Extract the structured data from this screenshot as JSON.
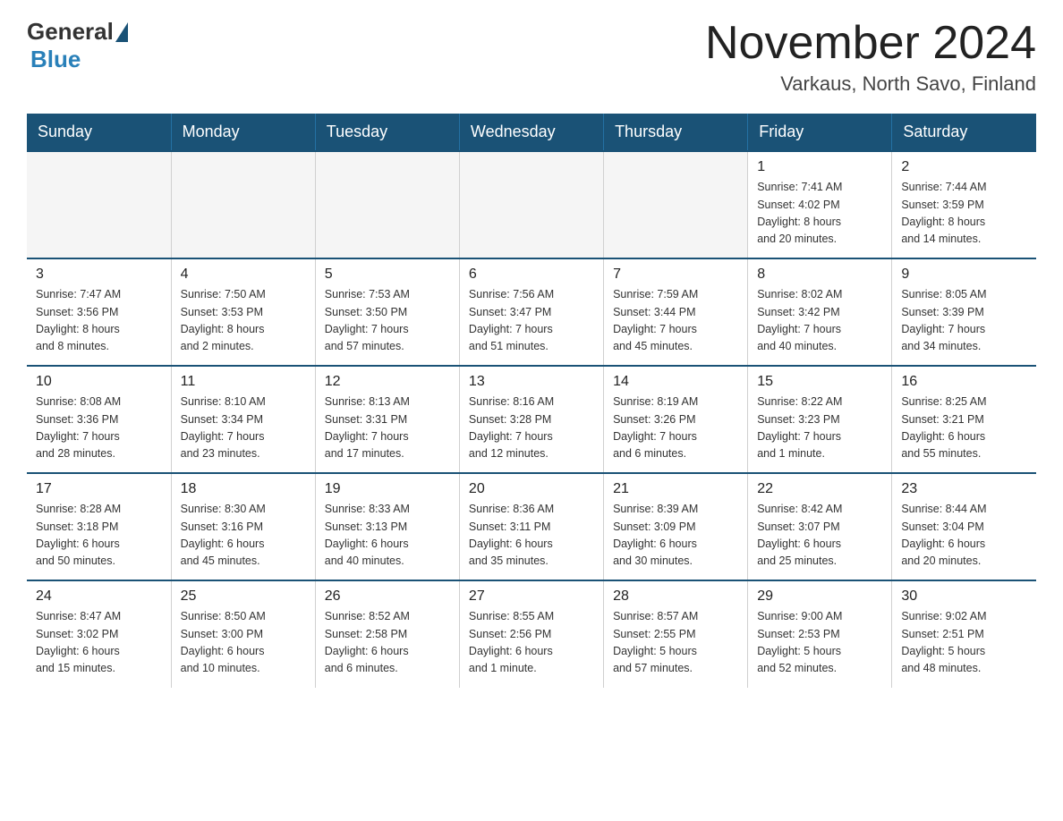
{
  "logo": {
    "general": "General",
    "blue": "Blue"
  },
  "header": {
    "month_title": "November 2024",
    "location": "Varkaus, North Savo, Finland"
  },
  "days_of_week": [
    "Sunday",
    "Monday",
    "Tuesday",
    "Wednesday",
    "Thursday",
    "Friday",
    "Saturday"
  ],
  "weeks": [
    {
      "cells": [
        {
          "day": "",
          "info": "",
          "empty": true
        },
        {
          "day": "",
          "info": "",
          "empty": true
        },
        {
          "day": "",
          "info": "",
          "empty": true
        },
        {
          "day": "",
          "info": "",
          "empty": true
        },
        {
          "day": "",
          "info": "",
          "empty": true
        },
        {
          "day": "1",
          "info": "Sunrise: 7:41 AM\nSunset: 4:02 PM\nDaylight: 8 hours\nand 20 minutes.",
          "empty": false
        },
        {
          "day": "2",
          "info": "Sunrise: 7:44 AM\nSunset: 3:59 PM\nDaylight: 8 hours\nand 14 minutes.",
          "empty": false
        }
      ]
    },
    {
      "cells": [
        {
          "day": "3",
          "info": "Sunrise: 7:47 AM\nSunset: 3:56 PM\nDaylight: 8 hours\nand 8 minutes.",
          "empty": false
        },
        {
          "day": "4",
          "info": "Sunrise: 7:50 AM\nSunset: 3:53 PM\nDaylight: 8 hours\nand 2 minutes.",
          "empty": false
        },
        {
          "day": "5",
          "info": "Sunrise: 7:53 AM\nSunset: 3:50 PM\nDaylight: 7 hours\nand 57 minutes.",
          "empty": false
        },
        {
          "day": "6",
          "info": "Sunrise: 7:56 AM\nSunset: 3:47 PM\nDaylight: 7 hours\nand 51 minutes.",
          "empty": false
        },
        {
          "day": "7",
          "info": "Sunrise: 7:59 AM\nSunset: 3:44 PM\nDaylight: 7 hours\nand 45 minutes.",
          "empty": false
        },
        {
          "day": "8",
          "info": "Sunrise: 8:02 AM\nSunset: 3:42 PM\nDaylight: 7 hours\nand 40 minutes.",
          "empty": false
        },
        {
          "day": "9",
          "info": "Sunrise: 8:05 AM\nSunset: 3:39 PM\nDaylight: 7 hours\nand 34 minutes.",
          "empty": false
        }
      ]
    },
    {
      "cells": [
        {
          "day": "10",
          "info": "Sunrise: 8:08 AM\nSunset: 3:36 PM\nDaylight: 7 hours\nand 28 minutes.",
          "empty": false
        },
        {
          "day": "11",
          "info": "Sunrise: 8:10 AM\nSunset: 3:34 PM\nDaylight: 7 hours\nand 23 minutes.",
          "empty": false
        },
        {
          "day": "12",
          "info": "Sunrise: 8:13 AM\nSunset: 3:31 PM\nDaylight: 7 hours\nand 17 minutes.",
          "empty": false
        },
        {
          "day": "13",
          "info": "Sunrise: 8:16 AM\nSunset: 3:28 PM\nDaylight: 7 hours\nand 12 minutes.",
          "empty": false
        },
        {
          "day": "14",
          "info": "Sunrise: 8:19 AM\nSunset: 3:26 PM\nDaylight: 7 hours\nand 6 minutes.",
          "empty": false
        },
        {
          "day": "15",
          "info": "Sunrise: 8:22 AM\nSunset: 3:23 PM\nDaylight: 7 hours\nand 1 minute.",
          "empty": false
        },
        {
          "day": "16",
          "info": "Sunrise: 8:25 AM\nSunset: 3:21 PM\nDaylight: 6 hours\nand 55 minutes.",
          "empty": false
        }
      ]
    },
    {
      "cells": [
        {
          "day": "17",
          "info": "Sunrise: 8:28 AM\nSunset: 3:18 PM\nDaylight: 6 hours\nand 50 minutes.",
          "empty": false
        },
        {
          "day": "18",
          "info": "Sunrise: 8:30 AM\nSunset: 3:16 PM\nDaylight: 6 hours\nand 45 minutes.",
          "empty": false
        },
        {
          "day": "19",
          "info": "Sunrise: 8:33 AM\nSunset: 3:13 PM\nDaylight: 6 hours\nand 40 minutes.",
          "empty": false
        },
        {
          "day": "20",
          "info": "Sunrise: 8:36 AM\nSunset: 3:11 PM\nDaylight: 6 hours\nand 35 minutes.",
          "empty": false
        },
        {
          "day": "21",
          "info": "Sunrise: 8:39 AM\nSunset: 3:09 PM\nDaylight: 6 hours\nand 30 minutes.",
          "empty": false
        },
        {
          "day": "22",
          "info": "Sunrise: 8:42 AM\nSunset: 3:07 PM\nDaylight: 6 hours\nand 25 minutes.",
          "empty": false
        },
        {
          "day": "23",
          "info": "Sunrise: 8:44 AM\nSunset: 3:04 PM\nDaylight: 6 hours\nand 20 minutes.",
          "empty": false
        }
      ]
    },
    {
      "cells": [
        {
          "day": "24",
          "info": "Sunrise: 8:47 AM\nSunset: 3:02 PM\nDaylight: 6 hours\nand 15 minutes.",
          "empty": false
        },
        {
          "day": "25",
          "info": "Sunrise: 8:50 AM\nSunset: 3:00 PM\nDaylight: 6 hours\nand 10 minutes.",
          "empty": false
        },
        {
          "day": "26",
          "info": "Sunrise: 8:52 AM\nSunset: 2:58 PM\nDaylight: 6 hours\nand 6 minutes.",
          "empty": false
        },
        {
          "day": "27",
          "info": "Sunrise: 8:55 AM\nSunset: 2:56 PM\nDaylight: 6 hours\nand 1 minute.",
          "empty": false
        },
        {
          "day": "28",
          "info": "Sunrise: 8:57 AM\nSunset: 2:55 PM\nDaylight: 5 hours\nand 57 minutes.",
          "empty": false
        },
        {
          "day": "29",
          "info": "Sunrise: 9:00 AM\nSunset: 2:53 PM\nDaylight: 5 hours\nand 52 minutes.",
          "empty": false
        },
        {
          "day": "30",
          "info": "Sunrise: 9:02 AM\nSunset: 2:51 PM\nDaylight: 5 hours\nand 48 minutes.",
          "empty": false
        }
      ]
    }
  ]
}
